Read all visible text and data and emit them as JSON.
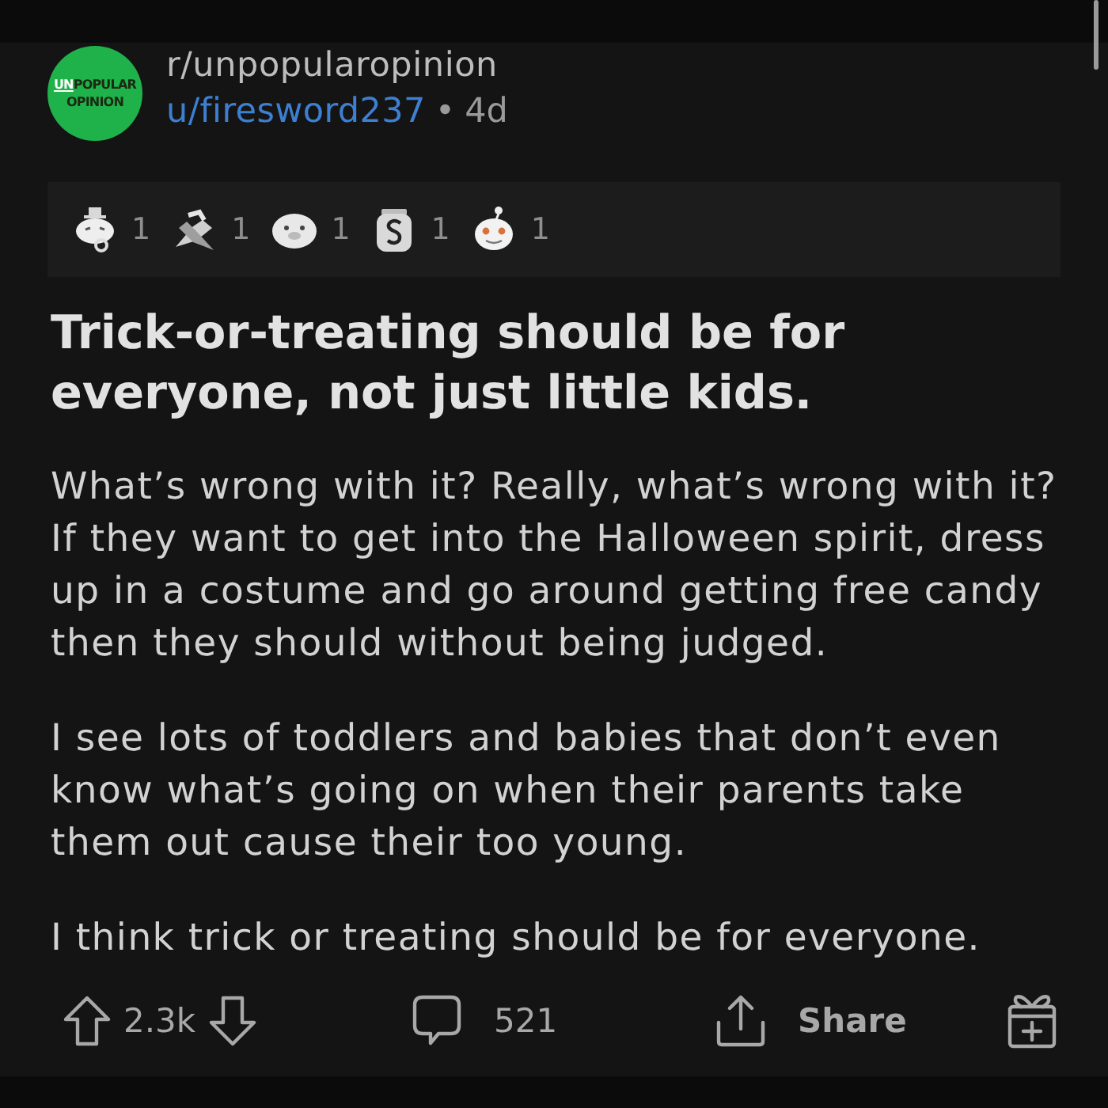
{
  "header": {
    "logo": {
      "prefix": "UN",
      "rest": "POPULAR",
      "line_2": "OPINION"
    },
    "subreddit": "r/unpopularopinion",
    "user": "u/firesword237",
    "separator": "•",
    "age": "4d"
  },
  "awards": [
    {
      "kind": "top-hat",
      "count": "1"
    },
    {
      "kind": "hands",
      "count": "1"
    },
    {
      "kind": "seal",
      "count": "1"
    },
    {
      "kind": "jar",
      "count": "1"
    },
    {
      "kind": "alien",
      "count": "1"
    }
  ],
  "post": {
    "title": "Trick-or-treating should be for everyone, not just little kids.",
    "paragraphs": [
      "What’s wrong with it? Really, what’s wrong with it? If they want to get into the Halloween spirit, dress up in a costume and go around getting free candy then they should without being judged.",
      "I see lots of toddlers and babies that don’t even know what’s going on when their parents take them out cause their too young.",
      "I think trick or treating should be for everyone."
    ]
  },
  "actions": {
    "upvotes": "2.3k",
    "comments": "521",
    "share": "Share"
  }
}
